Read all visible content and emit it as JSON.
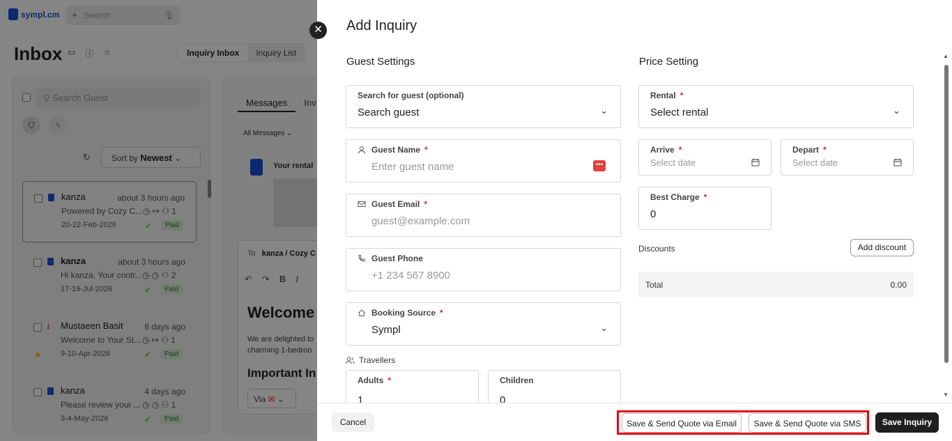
{
  "bg": {
    "logo": "sympl.cm",
    "search_placeholder": "Search",
    "title": "Inbox",
    "tabs": [
      "Inquiry Inbox",
      "Inquiry List"
    ],
    "search_guest_placeholder": "Search Guest",
    "sort_label": "Sort by",
    "sort_value": "Newest",
    "conversations": [
      {
        "name": "kanza",
        "time": "about 3 hours ago",
        "preview": "Powered by Cozy C...",
        "dates": "20-22-Feb-2026",
        "guests": "1",
        "status": "Paid"
      },
      {
        "name": "kanza",
        "time": "about 3 hours ago",
        "preview": "Hi kanza, Your contr...",
        "dates": "17-19-Jul-2026",
        "guests": "2",
        "status": "Paid"
      },
      {
        "name": "Mustaeen Basit",
        "time": "8 days ago",
        "preview": "Welcome to Your St...",
        "dates": "9-10-Apr-2026",
        "guests": "1",
        "status": "Paid"
      },
      {
        "name": "kanza",
        "time": "4 days ago",
        "preview": "Please review your ...",
        "dates": "3-4-May-2026",
        "guests": "1",
        "status": "Paid"
      }
    ],
    "msg_tabs": [
      "Messages",
      "Inv"
    ],
    "all_messages": "All Messages",
    "your_rental": "Your rental",
    "to_label": "To",
    "to_value": "kanza / Cozy C",
    "welcome": "Welcome",
    "body_text": "We are delighted to charming 1-bedroo",
    "important": "Important In",
    "via": "Via"
  },
  "drawer": {
    "title": "Add Inquiry",
    "guest_section": "Guest Settings",
    "price_section": "Price Setting",
    "search_guest": {
      "label": "Search for guest (optional)",
      "value": "Search guest"
    },
    "guest_name": {
      "label": "Guest Name",
      "placeholder": "Enter guest name"
    },
    "guest_email": {
      "label": "Guest Email",
      "placeholder": "guest@example.com"
    },
    "guest_phone": {
      "label": "Guest Phone",
      "placeholder": "+1 234 567 8900"
    },
    "booking_source": {
      "label": "Booking Source",
      "value": "Sympl"
    },
    "travellers_label": "Travellers",
    "adults": {
      "label": "Adults",
      "value": "1"
    },
    "children": {
      "label": "Children",
      "value": "0"
    },
    "rental": {
      "label": "Rental",
      "value": "Select rental"
    },
    "arrive": {
      "label": "Arrive",
      "placeholder": "Select date"
    },
    "depart": {
      "label": "Depart",
      "placeholder": "Select date"
    },
    "best_charge": {
      "label": "Best Charge",
      "value": "0"
    },
    "discounts_label": "Discounts",
    "add_discount": "Add discount",
    "total_label": "Total",
    "total_value": "0.00",
    "required_mark": "*"
  },
  "footer": {
    "cancel": "Cancel",
    "send_email": "Save & Send Quote via Email",
    "send_sms": "Save & Send Quote via SMS",
    "save": "Save Inquiry"
  },
  "colors": {
    "highlight": "#e8000b",
    "primary_dark": "#1f1f1f",
    "required": "#d62a2a",
    "brand": "#1a4fd6"
  }
}
